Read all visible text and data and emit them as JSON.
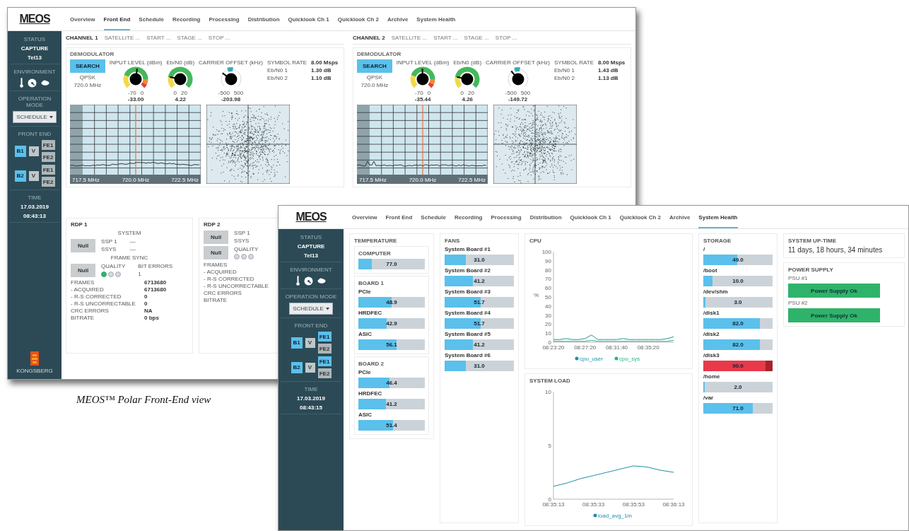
{
  "front_end_window": {
    "kind": "front_end",
    "logo": "MEOS",
    "nav": [
      {
        "label": "Overview",
        "selected": false
      },
      {
        "label": "Front End",
        "selected": true
      },
      {
        "label": "Schedule",
        "selected": false
      },
      {
        "label": "Recording",
        "selected": false
      },
      {
        "label": "Processing",
        "selected": false
      },
      {
        "label": "Distribution",
        "selected": false
      },
      {
        "label": "Quicklook Ch 1",
        "selected": false
      },
      {
        "label": "Quicklook Ch 2",
        "selected": false
      },
      {
        "label": "Archive",
        "selected": false
      },
      {
        "label": "System Health",
        "selected": false
      }
    ],
    "sidebar": {
      "sections": [
        {
          "kind": "status",
          "heading": "STATUS",
          "lines": [
            "CAPTURE",
            "Tel13"
          ]
        },
        {
          "kind": "icons",
          "heading": "ENVIRONMENT"
        },
        {
          "kind": "dropdown",
          "heading": "OPERATION MODE",
          "value": "SCHEDULE"
        },
        {
          "kind": "frontend",
          "heading": "FRONT END",
          "rows": [
            {
              "band": "B1",
              "band_on": true,
              "pol": "V",
              "units": [
                {
                  "label": "FE1",
                  "on": false
                },
                {
                  "label": "FE2",
                  "on": false
                }
              ]
            },
            {
              "band": "B2",
              "band_on": true,
              "pol": "V",
              "units": [
                {
                  "label": "FE1",
                  "on": false
                },
                {
                  "label": "FE2",
                  "on": false
                }
              ]
            }
          ]
        },
        {
          "kind": "status",
          "heading": "TIME",
          "lines": [
            "17.03.2019",
            "08:43:13"
          ]
        }
      ],
      "brand": "KONGSBERG"
    },
    "channels": [
      {
        "title": "CHANNEL 1",
        "tabs": [
          "SATELLITE ...",
          "START ...",
          "STAGE ...",
          "STOP ..."
        ],
        "section": "DEMODULATOR",
        "button": "SEARCH",
        "modulation": "QPSK",
        "frequency": "720.0 MHz",
        "gauges": [
          {
            "kind": "level",
            "label": "INPUT LEVEL (dBm)",
            "ticks": [
              "-70",
              "0"
            ],
            "reading": "-33.00"
          },
          {
            "kind": "quality",
            "label": "Eb/N0 (dB)",
            "ticks": [
              "0",
              "20"
            ],
            "reading": "4.22"
          },
          {
            "kind": "offset",
            "label": "CARRIER OFFSET (kHz)",
            "ticks": [
              "-500",
              "500"
            ],
            "reading": "-203.98"
          }
        ],
        "stats": [
          {
            "label": "SYMBOL RATE",
            "value": "8.00 Msps"
          },
          {
            "label": "Eb/N0 1",
            "value": "1.30 dB"
          },
          {
            "label": "Eb/N0 2",
            "value": "1.10 dB"
          }
        ],
        "spectrum_axis": [
          "717.5 MHz",
          "720.0 MHz",
          "722.5 MHz"
        ]
      },
      {
        "title": "CHANNEL 2",
        "tabs": [
          "SATELLITE ...",
          "START ...",
          "STAGE ...",
          "STOP ..."
        ],
        "section": "DEMODULATOR",
        "button": "SEARCH",
        "modulation": "QPSK",
        "frequency": "720.0 MHz",
        "gauges": [
          {
            "kind": "level",
            "label": "INPUT LEVEL (dBm)",
            "ticks": [
              "-70",
              "0"
            ],
            "reading": "-35.44"
          },
          {
            "kind": "quality",
            "label": "Eb/N0 (dB)",
            "ticks": [
              "0",
              "20"
            ],
            "reading": "4.26"
          },
          {
            "kind": "offset",
            "label": "CARRIER OFFSET (kHz)",
            "ticks": [
              "-500",
              "500"
            ],
            "reading": "-149.72"
          }
        ],
        "stats": [
          {
            "label": "SYMBOL RATE",
            "value": "8.00 Msps"
          },
          {
            "label": "Eb/N0 1",
            "value": "1.43 dB"
          },
          {
            "label": "Eb/N0 2",
            "value": "1.13 dB"
          }
        ],
        "spectrum_axis": [
          "717.5 MHz",
          "720.0 MHz",
          "722.5 MHz"
        ]
      }
    ],
    "rdps": [
      {
        "title": "RDP 1",
        "system_heading": "SYSTEM",
        "system_button": "Null",
        "system_fields": [
          {
            "label": "SSP 1",
            "value": "—"
          },
          {
            "label": "SSYS",
            "value": "—"
          }
        ],
        "sync_heading": "FRAME SYNC",
        "sync_button": "Null",
        "quality_label": "QUALITY",
        "quality_lights": [
          {
            "on": true
          },
          {
            "on": false
          },
          {
            "on": false
          }
        ],
        "errors_label": "BIT ERRORS",
        "errors_value": "1",
        "rows": [
          {
            "label": "FRAMES",
            "value": "6713680"
          },
          {
            "label": "- ACQUIRED",
            "value": "6713680"
          },
          {
            "label": "- R-S CORRECTED",
            "value": "0"
          },
          {
            "label": "- R-S UNCORRECTABLE",
            "value": "0"
          },
          {
            "label": "CRC ERRORS",
            "value": "NA"
          },
          {
            "label": "BITRATE",
            "value": "0 bps"
          }
        ]
      },
      {
        "title": "RDP 2",
        "system_button": "Null",
        "system_fields": [
          {
            "label": "SSP 1"
          },
          {
            "label": "SSYS"
          }
        ],
        "sync_button": "Null",
        "quality_label": "QUALITY",
        "quality_lights": [
          {
            "on": false
          },
          {
            "on": false
          },
          {
            "on": false
          }
        ],
        "rows": [
          {
            "label": "FRAMES"
          },
          {
            "label": "- ACQUIRED"
          },
          {
            "label": "- R-S CORRECTED"
          },
          {
            "label": "- R-S UNCORRECTABLE"
          },
          {
            "label": "CRC ERRORS"
          },
          {
            "label": "BITRATE"
          }
        ]
      }
    ]
  },
  "health_window": {
    "kind": "system_health",
    "logo": "MEOS",
    "nav": [
      {
        "label": "Overview",
        "selected": false
      },
      {
        "label": "Front End",
        "selected": false
      },
      {
        "label": "Schedule",
        "selected": false
      },
      {
        "label": "Recording",
        "selected": false
      },
      {
        "label": "Processing",
        "selected": false
      },
      {
        "label": "Distribution",
        "selected": false
      },
      {
        "label": "Quicklook Ch 1",
        "selected": false
      },
      {
        "label": "Quicklook Ch 2",
        "selected": false
      },
      {
        "label": "Archive",
        "selected": false
      },
      {
        "label": "System Health",
        "selected": true
      }
    ],
    "sidebar": {
      "sections": [
        {
          "kind": "status",
          "heading": "STATUS",
          "lines": [
            "CAPTURE",
            "Tel13"
          ]
        },
        {
          "kind": "icons",
          "heading": "ENVIRONMENT"
        },
        {
          "kind": "dropdown",
          "heading": "OPERATION MODE",
          "value": "SCHEDULE"
        },
        {
          "kind": "frontend",
          "heading": "FRONT END",
          "rows": [
            {
              "band": "B1",
              "band_on": true,
              "pol": "V",
              "units": [
                {
                  "label": "FE1",
                  "on": true
                },
                {
                  "label": "FE2",
                  "on": false
                }
              ]
            },
            {
              "band": "B2",
              "band_on": true,
              "pol": "V",
              "units": [
                {
                  "label": "FE1",
                  "on": true
                },
                {
                  "label": "FE2",
                  "on": false
                }
              ]
            }
          ]
        },
        {
          "kind": "status",
          "heading": "TIME",
          "lines": [
            "17.03.2019",
            "08:43:15"
          ]
        }
      ]
    },
    "temperature": {
      "title": "TEMPERATURE",
      "groups": [
        {
          "title": "COMPUTER",
          "bars": [
            {
              "reading": "77.0",
              "level": 0.2
            }
          ]
        },
        {
          "title": "BOARD 1",
          "bars": [
            {
              "label": "PCIe",
              "reading": "48.9",
              "level": 0.5
            },
            {
              "label": "HRDFEC",
              "reading": "42.9",
              "level": 0.43
            },
            {
              "label": "ASIC",
              "reading": "56.1",
              "level": 0.57
            }
          ]
        },
        {
          "title": "BOARD 2",
          "bars": [
            {
              "label": "PCIe",
              "reading": "46.4",
              "level": 0.47
            },
            {
              "label": "HRDFEC",
              "reading": "41.2",
              "level": 0.42
            },
            {
              "label": "ASIC",
              "reading": "51.4",
              "level": 0.52
            }
          ]
        }
      ]
    },
    "fans": {
      "title": "FANS",
      "bars": [
        {
          "label": "System Board #1",
          "reading": "31.0",
          "level": 0.31
        },
        {
          "label": "System Board #2",
          "reading": "41.2",
          "level": 0.41
        },
        {
          "label": "System Board #3",
          "reading": "51.7",
          "level": 0.52
        },
        {
          "label": "System Board #4",
          "reading": "51.7",
          "level": 0.52
        },
        {
          "label": "System Board #5",
          "reading": "41.2",
          "level": 0.41
        },
        {
          "label": "System Board #6",
          "reading": "31.0",
          "level": 0.31
        }
      ]
    },
    "cpu": {
      "title": "CPU",
      "chart_data": {
        "type": "line",
        "ylabel": "%",
        "categories": [
          "08:23:20",
          null,
          null,
          null,
          null,
          "08:27:20",
          null,
          null,
          null,
          null,
          "08:31:40",
          null,
          null,
          null,
          null,
          "08:35:20",
          null,
          null,
          null,
          null
        ],
        "ylim": [
          0,
          100
        ],
        "yticks": [
          0,
          10,
          20,
          30,
          40,
          50,
          60,
          70,
          80,
          90,
          100
        ],
        "series": [
          {
            "name": "cpu_user",
            "color": "#1f8fa8",
            "values": [
              3,
              3,
              4,
              3,
              3,
              4,
              8,
              3,
              3,
              3,
              3,
              4,
              3,
              3,
              3,
              3,
              3,
              3,
              4,
              6
            ]
          },
          {
            "name": "cpu_sys",
            "color": "#2bb37a",
            "values": [
              1,
              1,
              1,
              1,
              1,
              1,
              2,
              1,
              1,
              1,
              1,
              1,
              1,
              1,
              1,
              1,
              1,
              1,
              1,
              2
            ]
          }
        ]
      }
    },
    "system_load": {
      "title": "SYSTEM LOAD",
      "chart_data": {
        "type": "line",
        "categories": [
          "08:35:13",
          null,
          null,
          "08:35:33",
          null,
          null,
          "08:35:53",
          null,
          null,
          "08:36:13"
        ],
        "ylim": [
          0,
          10
        ],
        "yticks": [
          0,
          5,
          10
        ],
        "series": [
          {
            "name": "load_avg_1m",
            "color": "#1f8fa8",
            "values": [
              1.2,
              1.5,
              1.9,
              2.2,
              2.5,
              2.8,
              3.1,
              3.0,
              2.7,
              2.5
            ]
          }
        ]
      }
    },
    "storage": {
      "title": "STORAGE",
      "bars": [
        {
          "label": "/",
          "reading": "49.0",
          "level": 0.49,
          "alert": false
        },
        {
          "label": "/boot",
          "reading": "10.0",
          "level": 0.13,
          "alert": false
        },
        {
          "label": "/dev/shm",
          "reading": "3.0",
          "level": 0.03,
          "alert": false
        },
        {
          "label": "/disk1",
          "reading": "82.0",
          "level": 0.82,
          "alert": false
        },
        {
          "label": "/disk2",
          "reading": "82.0",
          "level": 0.82,
          "alert": false
        },
        {
          "label": "/disk3",
          "reading": "90.0",
          "level": 0.9,
          "alert": true
        },
        {
          "label": "/home",
          "reading": "2.0",
          "level": 0.02,
          "alert": false
        },
        {
          "label": "/var",
          "reading": "71.0",
          "level": 0.71,
          "alert": false
        }
      ]
    },
    "uptime": {
      "title": "SYSTEM UP-TIME",
      "value": "11 days, 18 hours, 34 minutes"
    },
    "power_supply": {
      "title": "POWER SUPPLY",
      "units": [
        {
          "label": "PSU #1",
          "status": "Power Supply Ok",
          "ok": true
        },
        {
          "label": "PSU #2",
          "status": "Power Supply Ok",
          "ok": true
        }
      ]
    }
  },
  "caption": "MEOS™ Polar Front-End view"
}
